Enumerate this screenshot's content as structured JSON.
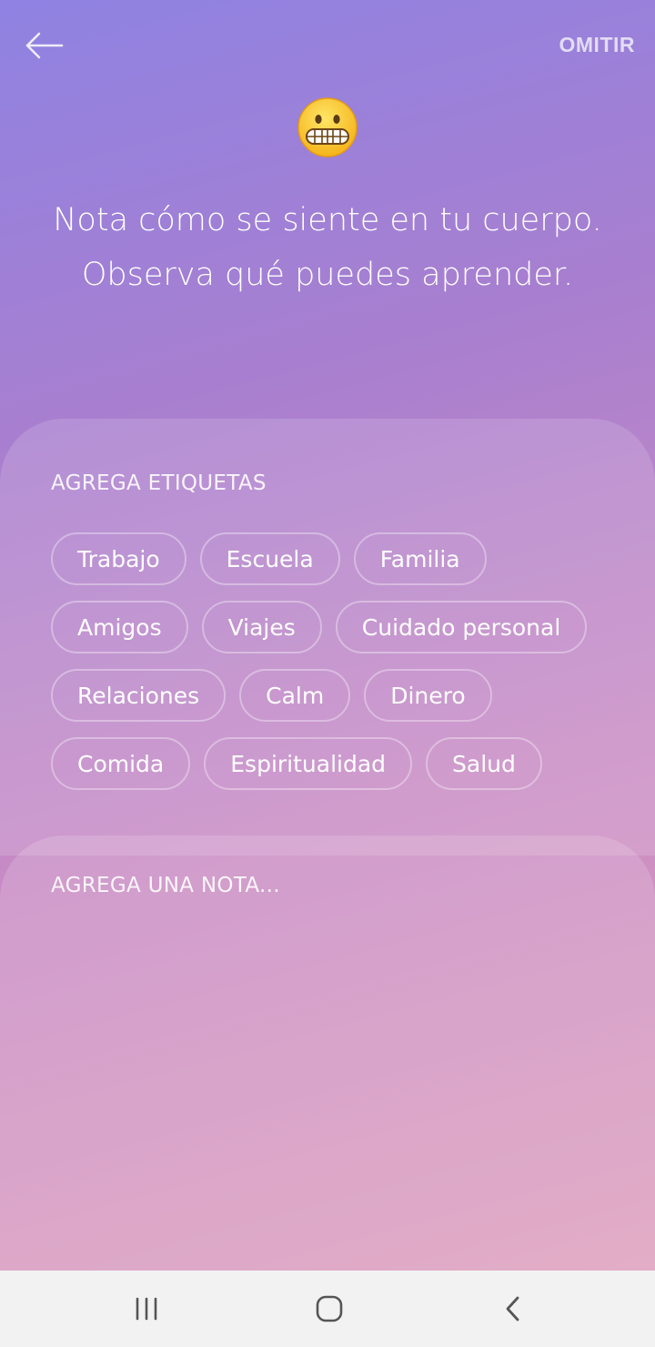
{
  "header": {
    "back_icon": "arrow-left-icon",
    "skip_label": "OMITIR"
  },
  "mood": {
    "emoji_icon": "grimacing-face-emoji"
  },
  "prompt": {
    "line1": "Nota cómo se siente en tu cuerpo.",
    "line2": "Observa qué puedes aprender."
  },
  "tags": {
    "label": "AGREGA ETIQUETAS",
    "items": [
      "Trabajo",
      "Escuela",
      "Familia",
      "Amigos",
      "Viajes",
      "Cuidado personal",
      "Relaciones",
      "Calm",
      "Dinero",
      "Comida",
      "Espiritualidad",
      "Salud"
    ]
  },
  "note": {
    "placeholder": "AGREGA UNA NOTA..."
  },
  "nav": {
    "recent_icon": "recent-apps-icon",
    "home_icon": "home-icon",
    "back_icon": "system-back-icon"
  },
  "colors": {
    "gradient_top": "#8f82e2",
    "gradient_bottom": "#e1a2bc",
    "nav_background": "#f2f2f2"
  }
}
